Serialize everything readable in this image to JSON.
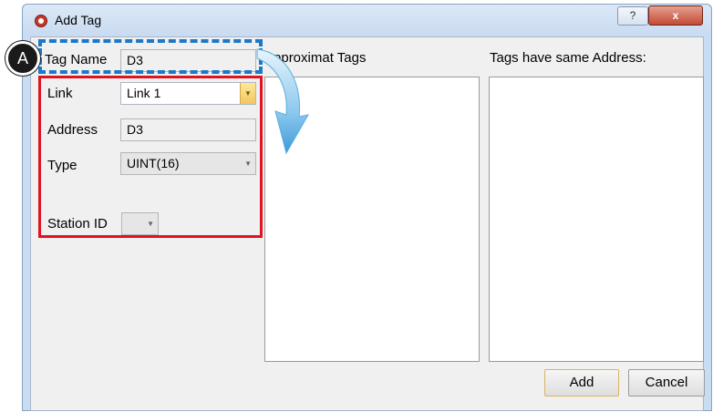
{
  "window": {
    "title": "Add Tag",
    "help_label": "?",
    "close_label": "x"
  },
  "form": {
    "tag_name_label": "Tag Name",
    "tag_name_value": "D3",
    "link_label": "Link",
    "link_value": "Link 1",
    "address_label": "Address",
    "address_value": "D3",
    "type_label": "Type",
    "type_value": "UINT(16)",
    "station_id_label": "Station ID",
    "station_id_value": ""
  },
  "lists": {
    "approx_label": "Approximat Tags",
    "same_address_label": "Tags have same Address:"
  },
  "buttons": {
    "add_label": "Add",
    "cancel_label": "Cancel"
  },
  "annotation": {
    "badge_label": "A",
    "dashed_color": "#1c79c9",
    "highlight_color": "#e0141e"
  }
}
